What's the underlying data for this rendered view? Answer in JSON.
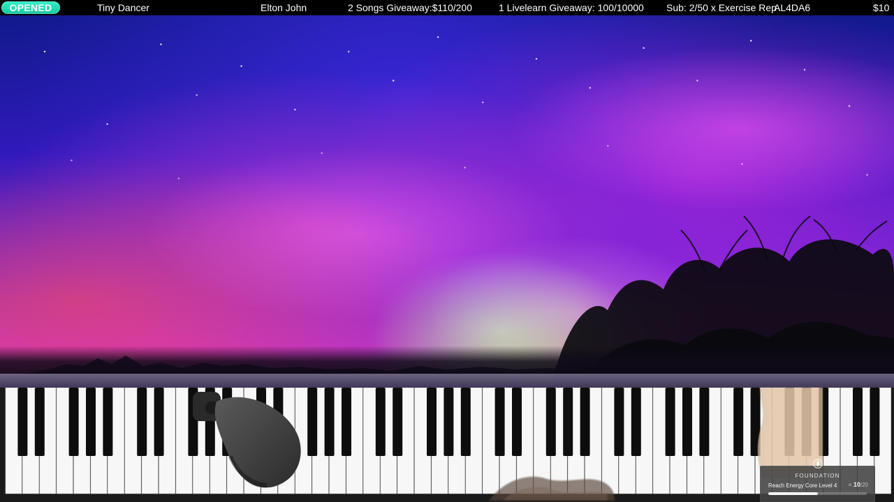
{
  "topbar": {
    "status_pill": "OPENED",
    "song_title": "Tiny Dancer",
    "artist": "Elton John",
    "songs_giveaway": "2 Songs Giveaway:$110/200",
    "livelearn_giveaway": "1 Livelearn Giveaway: 100/10000",
    "sub_counter": "Sub: 2/50 x Exercise Rep",
    "code": "AL4DA6",
    "amount": "$10"
  },
  "colors": {
    "pill_accent": "#1FD6AE",
    "topbar_bg": "#000000",
    "widget_bg": "#424242"
  },
  "widget": {
    "brand": "FOUNDATION",
    "goal_label": "Reach Energy Core Level 4",
    "progress_current": "10",
    "progress_total": "/20",
    "progress_fraction": 0.5
  },
  "icons": {
    "widget_logo": "flame-icon",
    "microphone": "microphone-icon"
  }
}
